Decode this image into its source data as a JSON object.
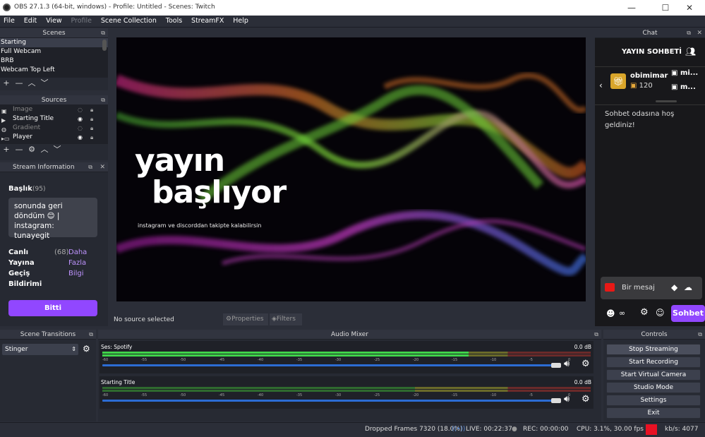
{
  "window": {
    "title": "OBS 27.1.3 (64-bit, windows) - Profile: Untitled - Scenes: Twitch"
  },
  "menu": [
    "File",
    "Edit",
    "View",
    "Profile",
    "Scene Collection",
    "Tools",
    "StreamFX",
    "Help"
  ],
  "scenes": {
    "title": "Scenes",
    "items": [
      "Starting",
      "Full Webcam",
      "BRB",
      "Webcam Top Left"
    ]
  },
  "sources": {
    "title": "Sources",
    "items": [
      {
        "name": "Image",
        "visible": false
      },
      {
        "name": "Starting Title",
        "visible": true
      },
      {
        "name": "Gradient",
        "visible": false
      },
      {
        "name": "Player",
        "visible": true
      }
    ]
  },
  "stream_info": {
    "title": "Stream Information",
    "baslik_label": "Başlık",
    "baslik_count": "(95)",
    "baslik_value": "sonunda geri döndüm 😊 | instagram: tunayegit",
    "canli_label": "Canlı",
    "yayina_label": "Yayına",
    "gecis_label": "Geçiş",
    "bildirimi_label": "Bildirimi",
    "canli_count": "(68)",
    "daha": "Daha",
    "fazla": "Fazla",
    "bilgi": "Bilgi",
    "done_button": "Bitti"
  },
  "preview": {
    "line1": "yayın",
    "line2": "başlıyor",
    "subtitle": "instagram ve discorddan takipte kalabilirsin",
    "status": "No source selected",
    "properties_label": "Properties",
    "filters_label": "Filters"
  },
  "chat": {
    "dock_title": "Chat",
    "header": "YAYIN SOHBETİ",
    "gifter_name": "obimimar",
    "gifter_count": "120",
    "user1": "mi...",
    "user2": "m...",
    "welcome": "Sohbet odasına hoş geldiniz!",
    "input_placeholder": "Bir mesaj",
    "infinity": "∞",
    "send_button": "Sohbet"
  },
  "transitions": {
    "title": "Scene Transitions",
    "selected": "Stinger"
  },
  "audio": {
    "title": "Audio Mixer",
    "channels": [
      {
        "name": "Ses: Spotify",
        "db": "0.0 dB",
        "level": 0.75
      },
      {
        "name": "Starting Title",
        "db": "0.0 dB",
        "level": 0.0
      }
    ],
    "ticks": [
      "-60",
      "-55",
      "-50",
      "-45",
      "-40",
      "-35",
      "-30",
      "-25",
      "-20",
      "-15",
      "-10",
      "-5",
      "0"
    ]
  },
  "controls": {
    "title": "Controls",
    "buttons": [
      "Stop Streaming",
      "Start Recording",
      "Start Virtual Camera",
      "Studio Mode",
      "Settings",
      "Exit"
    ]
  },
  "status": {
    "dropped": "Dropped Frames 7320 (18.0%)",
    "live": "LIVE: 00:22:37",
    "rec": "REC: 00:00:00",
    "cpu": "CPU: 3.1%, 30.00 fps",
    "kbps": "kb/s: 4077"
  },
  "colors": {
    "accent": "#9147ff",
    "live_red": "#e81123"
  }
}
